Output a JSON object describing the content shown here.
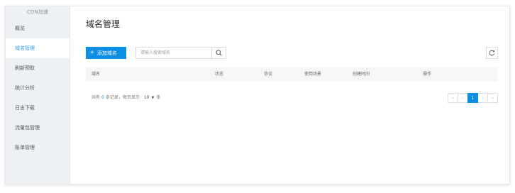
{
  "sidebar": {
    "title": "CDN加速",
    "items": [
      {
        "label": "概览",
        "active": false
      },
      {
        "label": "域名管理",
        "active": true
      },
      {
        "label": "刷新预取",
        "active": false
      },
      {
        "label": "统计分析",
        "active": false
      },
      {
        "label": "日志下载",
        "active": false
      },
      {
        "label": "流量包管理",
        "active": false
      },
      {
        "label": "账单管理",
        "active": false
      }
    ]
  },
  "main": {
    "title": "域名管理",
    "add_button": "添加域名",
    "search_placeholder": "请输入搜索域名",
    "table": {
      "columns": [
        "域名",
        "状态",
        "协议",
        "使用场景",
        "创建时间",
        "操作"
      ],
      "rows": []
    },
    "footer": {
      "prefix": "共有",
      "count": "0",
      "mid": "条记录，每页显示",
      "page_size": "10",
      "suffix": "条"
    },
    "pagination": {
      "first": "«",
      "prev": "‹",
      "current": "1",
      "next": "›",
      "last": "»"
    }
  },
  "colors": {
    "accent": "#0a8ee6",
    "sidebar_bg": "#eef1f3",
    "active_text": "#2a9be8"
  },
  "icons": {
    "search": "search-icon",
    "refresh": "refresh-icon",
    "add": "plus-icon",
    "dropdown": "caret-down-icon"
  }
}
